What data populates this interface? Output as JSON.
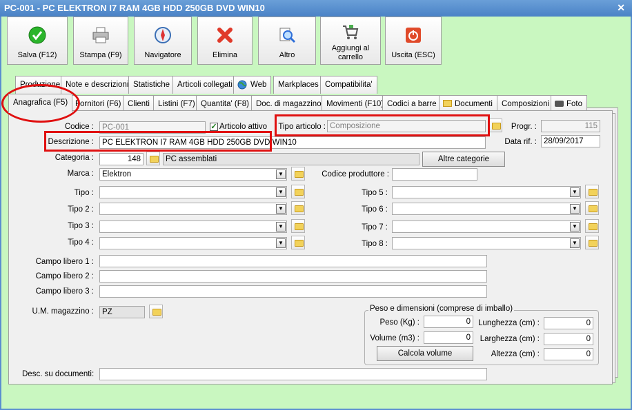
{
  "window": {
    "title": "PC-001 - PC ELEKTRON I7 RAM 4GB HDD 250GB DVD WIN10",
    "close_glyph": "✕"
  },
  "toolbar": [
    {
      "label": "Salva (F12)",
      "icon": "check-icon",
      "color": "#2bb52b"
    },
    {
      "label": "Stampa (F9)",
      "icon": "printer-icon",
      "color": "#888888"
    },
    {
      "label": "Navigatore",
      "icon": "compass-icon",
      "color": "#3b6fb5"
    },
    {
      "label": "Elimina",
      "icon": "delete-x-icon",
      "color": "#e03a2a"
    },
    {
      "label": "Altro",
      "icon": "magnifier-icon",
      "color": "#2f6fd8"
    },
    {
      "label": "Aggiungi al carrello",
      "icon": "cart-icon",
      "color": "#666666"
    },
    {
      "label": "Uscita (ESC)",
      "icon": "power-icon",
      "color": "#e04a2a"
    }
  ],
  "tabs_row1": [
    "Produzione",
    "Note e descrizioni",
    "Statistiche",
    "Articoli collegati",
    "Web",
    "Markplaces",
    "Compatibilita'"
  ],
  "tabs_row2": [
    "Anagrafica (F5)",
    "Fornitori (F6)",
    "Clienti",
    "Listini (F7)",
    "Quantita' (F8)",
    "Doc. di magazzino",
    "Movimenti (F10)",
    "Codici a barre",
    "Documenti",
    "Composizioni",
    "Foto"
  ],
  "form": {
    "codice_label": "Codice :",
    "codice_value": "PC-001",
    "articolo_attivo_label": "Articolo attivo",
    "tipo_articolo_label": "Tipo articolo :",
    "tipo_articolo_value": "Composizione",
    "progr_label": "Progr. :",
    "progr_value": "115",
    "descrizione_label": "Descrizione :",
    "descrizione_value": "PC ELEKTRON I7 RAM 4GB HDD 250GB DVD WIN10",
    "data_rif_label": "Data rif. :",
    "data_rif_value": "28/09/2017",
    "categoria_label": "Categoria :",
    "categoria_code": "148",
    "categoria_name": "PC assemblati",
    "altre_categorie_label": "Altre categorie",
    "marca_label": "Marca :",
    "marca_value": "Elektron",
    "codice_produttore_label": "Codice produttore :",
    "codice_produttore_value": "",
    "tipo_left": [
      "Tipo :",
      "Tipo 2 :",
      "Tipo 3 :",
      "Tipo 4 :"
    ],
    "tipo_right": [
      "Tipo 5 :",
      "Tipo 6 :",
      "Tipo 7 :",
      "Tipo 8 :"
    ],
    "campo_libero": [
      "Campo libero 1 :",
      "Campo libero 2 :",
      "Campo libero 3 :"
    ],
    "um_label": "U.M. magazzino :",
    "um_value": "PZ",
    "peso_group_title": "Peso e dimensioni (comprese di imballo)",
    "peso_label": "Peso (Kg) :",
    "peso_value": "0",
    "volume_label": "Volume (m3) :",
    "volume_value": "0",
    "calcola_volume_label": "Calcola volume",
    "lunghezza_label": "Lunghezza (cm) :",
    "lunghezza_value": "0",
    "larghezza_label": "Larghezza (cm) :",
    "larghezza_value": "0",
    "altezza_label": "Altezza (cm) :",
    "altezza_value": "0",
    "desc_documenti_label": "Desc. su documenti:",
    "desc_documenti_value": ""
  },
  "colors": {
    "window_bg": "#c9f7c0",
    "highlight": "#e01010",
    "titlebar": "#4a82c6"
  }
}
